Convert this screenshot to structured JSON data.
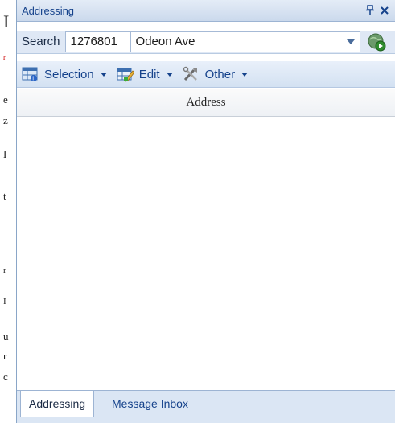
{
  "panel": {
    "title": "Addressing",
    "pin_glyph": "p",
    "close_glyph": "✕"
  },
  "search": {
    "label": "Search",
    "house_number": "1276801",
    "street": "Odeon Ave"
  },
  "toolbar": {
    "selection_label": "Selection",
    "edit_label": "Edit",
    "other_label": "Other"
  },
  "table": {
    "column_header": "Address"
  },
  "tabs": [
    {
      "label": "Addressing",
      "active": true
    },
    {
      "label": "Message Inbox",
      "active": false
    }
  ],
  "background_text": [
    "I",
    "r",
    "e",
    "z",
    "I",
    "t",
    "r",
    "I",
    "u",
    "r",
    "c"
  ]
}
